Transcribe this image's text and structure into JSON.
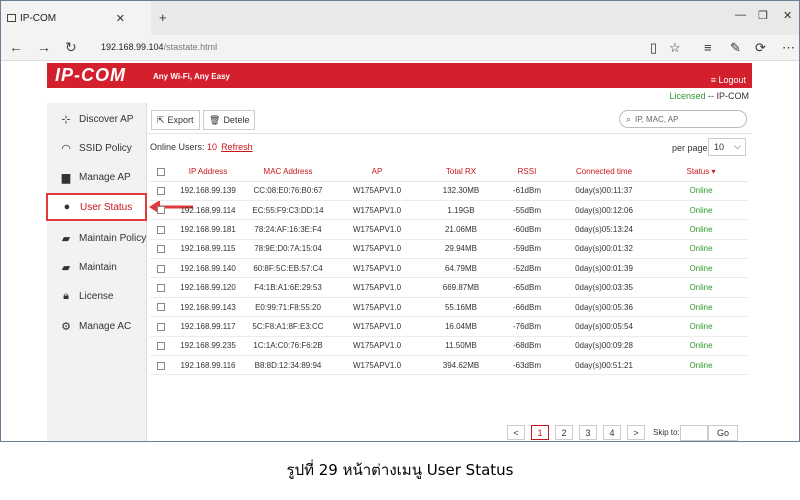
{
  "browser": {
    "tab_title": "IP-COM",
    "url_host": "192.168.99.104",
    "url_path": "/stastate.html"
  },
  "header": {
    "logo": "IP-COM",
    "tagline": "Any Wi-Fi, Any Easy",
    "logout": "Logout",
    "licensed_label": "Licensed",
    "licensed_value": "-- IP-COM"
  },
  "sidebar": {
    "items": [
      {
        "label": "Discover AP",
        "icon": "discover-icon"
      },
      {
        "label": "SSID Policy",
        "icon": "wifi-icon"
      },
      {
        "label": "Manage AP",
        "icon": "briefcase-icon"
      },
      {
        "label": "User Status",
        "icon": "user-icon"
      },
      {
        "label": "Maintain Policy",
        "icon": "folder-icon"
      },
      {
        "label": "Maintain",
        "icon": "folder-gear-icon"
      },
      {
        "label": "License",
        "icon": "lock-icon"
      },
      {
        "label": "Manage AC",
        "icon": "gears-icon"
      }
    ]
  },
  "toolbar": {
    "export": "Export",
    "delete": "Detele",
    "search_placeholder": "IP, MAC, AP"
  },
  "online": {
    "label": "Online Users:",
    "count": "10",
    "refresh": "Refresh"
  },
  "perpage": {
    "label": "per page",
    "value": "10"
  },
  "table": {
    "headers": [
      "IP Address",
      "MAC Address",
      "AP",
      "Total RX",
      "RSSI",
      "Connected time",
      "Status"
    ],
    "rows": [
      [
        "192.168.99.139",
        "CC:08:E0:76:B0:67",
        "W175APV1.0",
        "132.30MB",
        "-61dBm",
        "0day(s)00:11:37",
        "Online"
      ],
      [
        "192.168.99.114",
        "EC:55:F9:C3:DD:14",
        "W175APV1.0",
        "1.19GB",
        "-55dBm",
        "0day(s)00:12:06",
        "Online"
      ],
      [
        "192.168.99.181",
        "78:24:AF:16:3E:F4",
        "W175APV1.0",
        "21.06MB",
        "-60dBm",
        "0day(s)05:13:24",
        "Online"
      ],
      [
        "192.168.99.115",
        "78:9E:D0:7A:15:04",
        "W175APV1.0",
        "29.94MB",
        "-59dBm",
        "0day(s)00:01:32",
        "Online"
      ],
      [
        "192.168.99.140",
        "60:8F:5C:EB:57:C4",
        "W175APV1.0",
        "64.79MB",
        "-52dBm",
        "0day(s)00:01:39",
        "Online"
      ],
      [
        "192.168.99.120",
        "F4:1B:A1:6E:29:53",
        "W175APV1.0",
        "669.87MB",
        "-65dBm",
        "0day(s)00:03:35",
        "Online"
      ],
      [
        "192.168.99.143",
        "E0:99:71:F8:55:20",
        "W175APV1.0",
        "55.16MB",
        "-66dBm",
        "0day(s)00:05:36",
        "Online"
      ],
      [
        "192.168.99.117",
        "5C:F8:A1:8F:E3:CC",
        "W175APV1.0",
        "16.04MB",
        "-76dBm",
        "0day(s)00:05:54",
        "Online"
      ],
      [
        "192.168.99.235",
        "1C:1A:C0:76:F6:2B",
        "W175APV1.0",
        "11.50MB",
        "-68dBm",
        "0day(s)00:09:28",
        "Online"
      ],
      [
        "192.168.99.116",
        "B8:8D:12:34:89:94",
        "W175APV1.0",
        "394.62MB",
        "-63dBm",
        "0day(s)00:51:21",
        "Online"
      ]
    ]
  },
  "pager": {
    "prev": "<",
    "pages": [
      "1",
      "2",
      "3",
      "4"
    ],
    "next": ">",
    "skip_label": "Skip to:",
    "go": "Go"
  },
  "caption": "รูปที่ 29 หน้าต่างเมนู User Status",
  "colors": {
    "brand": "#d4202c",
    "online": "#2e9a2e",
    "accent": "#c8161d"
  }
}
